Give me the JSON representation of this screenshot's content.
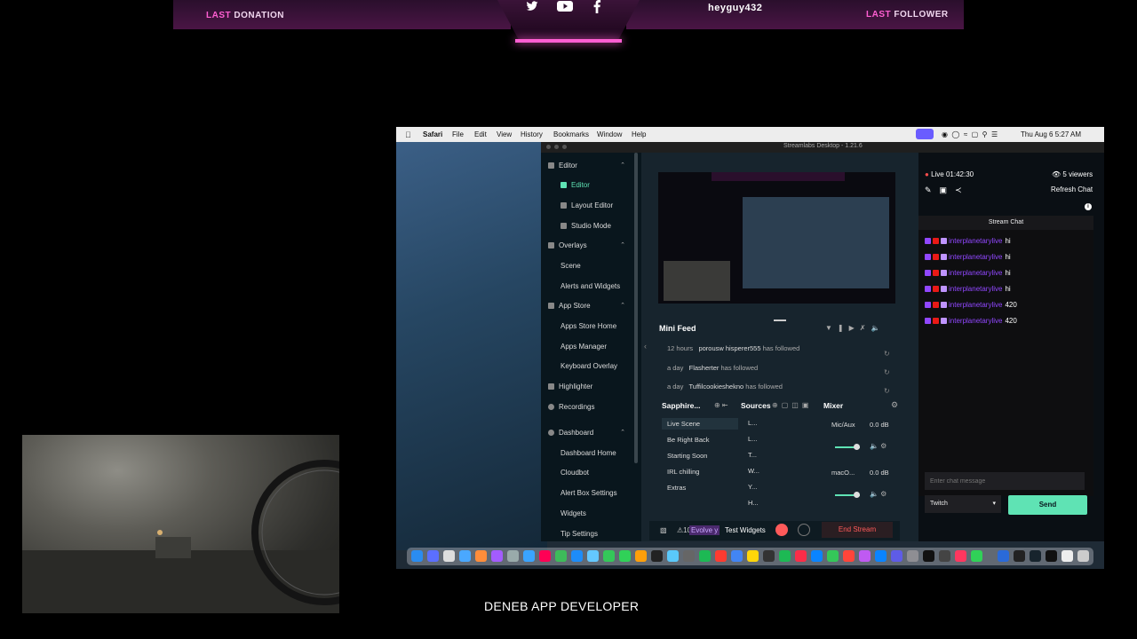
{
  "banner": {
    "last_donation_prefix": "LAST",
    "last_donation_label": "DONATION",
    "username": "heyguy432",
    "last_follower_prefix": "LAST",
    "last_follower_label": "FOLLOWER",
    "social_icons": [
      "twitter-icon",
      "youtube-icon",
      "facebook-icon"
    ]
  },
  "mac_menubar": {
    "app": "Safari",
    "menus": [
      "File",
      "Edit",
      "View",
      "History",
      "Bookmarks",
      "Window",
      "Help"
    ],
    "clock": "Thu Aug 6  5:27 AM"
  },
  "streamlabs": {
    "window_title": "Streamlabs Desktop - 1.21.6",
    "sidebar": {
      "editor_section": "Editor",
      "editor_items": [
        "Editor",
        "Layout Editor",
        "Studio Mode"
      ],
      "overlays_section": "Overlays",
      "overlays_items": [
        "Scene",
        "Alerts and Widgets"
      ],
      "appstore_section": "App Store",
      "appstore_items": [
        "Apps Store Home",
        "Apps Manager",
        "Keyboard Overlay"
      ],
      "highlighter": "Highlighter",
      "recordings": "Recordings",
      "dashboard_section": "Dashboard",
      "dashboard_items": [
        "Dashboard Home",
        "Cloudbot",
        "Alert Box Settings",
        "Widgets",
        "Tip Settings"
      ]
    },
    "mini_feed": {
      "title": "Mini Feed",
      "rows": [
        {
          "time": "12 hours",
          "user": "porousw hisperer555",
          "action": "has followed"
        },
        {
          "time": "a day",
          "user": "Flasherter",
          "action": "has followed"
        },
        {
          "time": "a day",
          "user": "Tuffilcookieshekno",
          "action": "has followed"
        }
      ]
    },
    "scenes": {
      "title": "Sapphire...",
      "items": [
        "Live Scene",
        "Be Right Back",
        "Starting Soon",
        "IRL chilling",
        "Extras"
      ]
    },
    "sources": {
      "title": "Sources",
      "items": [
        "L...",
        "L...",
        "T...",
        "W...",
        "Y...",
        "H..."
      ]
    },
    "mixer": {
      "title": "Mixer",
      "channels": [
        {
          "name": "Mic/Aux",
          "level": "0.0 dB",
          "fader": 0.9
        },
        {
          "name": "macO...",
          "level": "0.0 dB",
          "fader": 0.9
        }
      ]
    },
    "bottom_bar": {
      "warnings": "10",
      "evolve": "Evolve y",
      "test_widgets": "Test Widgets",
      "end_stream": "End Stream"
    },
    "chat": {
      "live_status": "Live 01:42:30",
      "viewers": "5 viewers",
      "refresh": "Refresh Chat",
      "title": "Stream Chat",
      "messages": [
        {
          "user": "interplanetarylive",
          "text": "hi"
        },
        {
          "user": "interplanetarylive",
          "text": "hi"
        },
        {
          "user": "interplanetarylive",
          "text": "hi"
        },
        {
          "user": "interplanetarylive",
          "text": "hi"
        },
        {
          "user": "interplanetarylive",
          "text": "420"
        },
        {
          "user": "interplanetarylive",
          "text": "420"
        }
      ],
      "input_placeholder": "Enter chat message",
      "platform": "Twitch",
      "send": "Send"
    }
  },
  "footer": {
    "title": "DENEB APP DEVELOPER"
  },
  "colors": {
    "accent_green": "#5fe3b4",
    "twitch_purple": "#9147ff",
    "end_stream_red": "#ff5a5a",
    "banner_pink": "#ff5fd2"
  }
}
